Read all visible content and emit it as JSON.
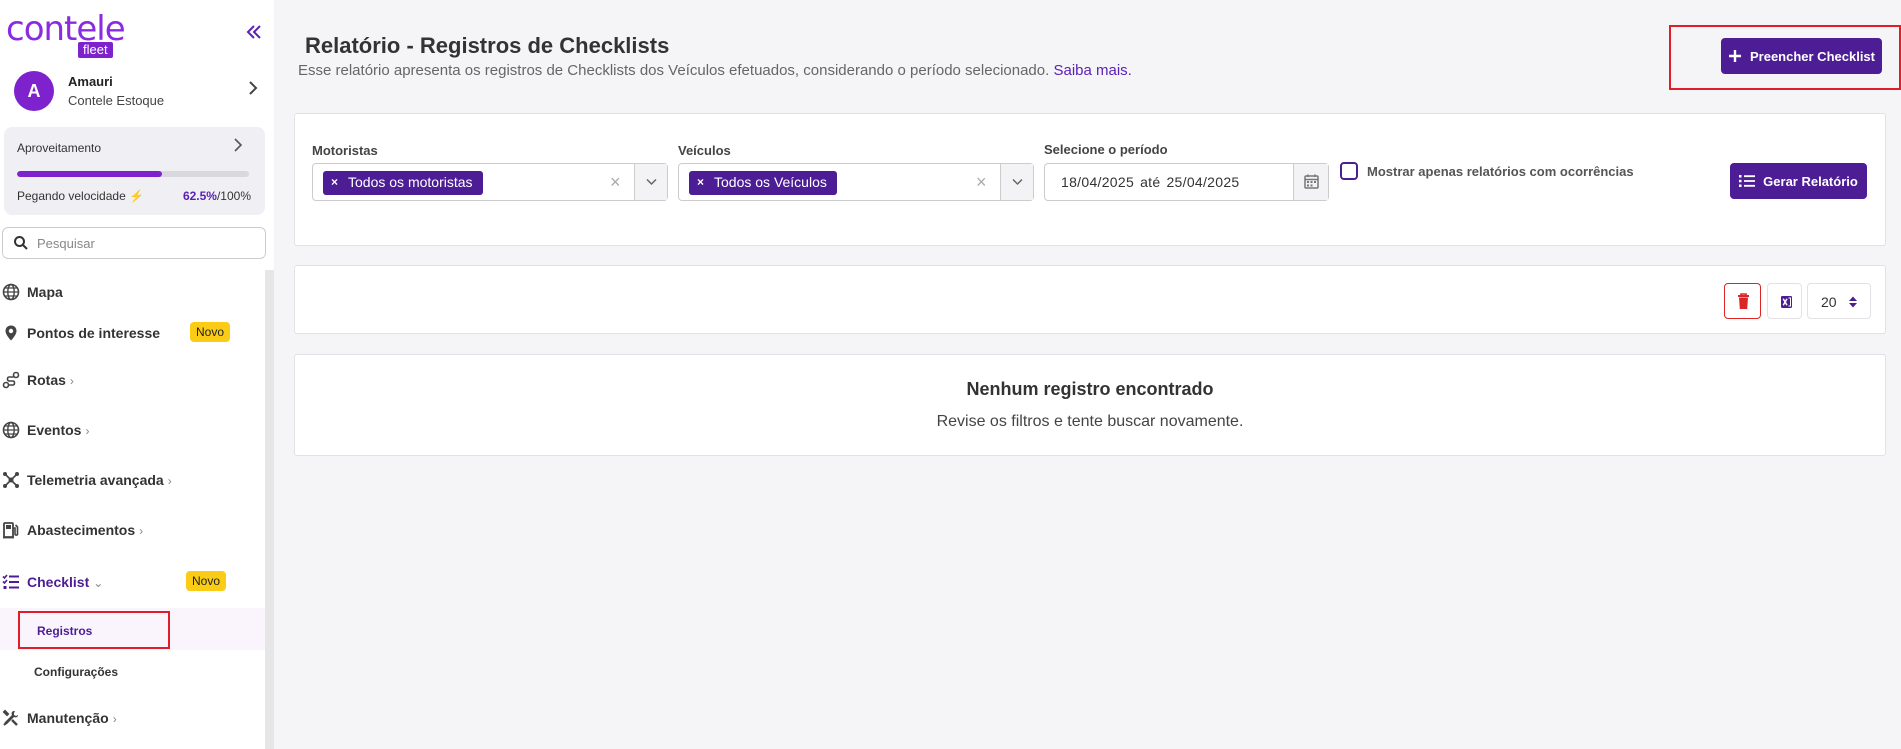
{
  "brand": {
    "logo_word": "contele",
    "logo_sub": "fleet",
    "accent": "#4c1d95",
    "primary": "#7e22ce"
  },
  "sidebar": {
    "collapse_icon": "double-chevron-left-icon",
    "user": {
      "initial": "A",
      "name": "Amauri",
      "company": "Contele Estoque"
    },
    "usage": {
      "title": "Aproveitamento",
      "status": "Pegando velocidade",
      "percent_label": "62.5%",
      "total_label": "/100%",
      "progress": 0.625
    },
    "search": {
      "placeholder": "Pesquisar"
    },
    "items": [
      {
        "label": "Mapa",
        "icon": "globe-icon",
        "chevron": ""
      },
      {
        "label": "Pontos de interesse",
        "icon": "map-pin-icon",
        "chevron": "",
        "badge": "Novo"
      },
      {
        "label": "Rotas",
        "icon": "route-icon",
        "chevron": "›"
      },
      {
        "label": "Eventos",
        "icon": "globe-icon",
        "chevron": "›"
      },
      {
        "label": "Telemetria avançada",
        "icon": "network-icon",
        "chevron": "›"
      },
      {
        "label": "Abastecimentos",
        "icon": "fuel-pump-icon",
        "chevron": "›"
      },
      {
        "label": "Checklist",
        "icon": "checklist-icon",
        "chevron": "⌄",
        "badge": "Novo"
      },
      {
        "label": "Manutenção",
        "icon": "tools-icon",
        "chevron": "›"
      }
    ],
    "subitems": [
      {
        "label": "Registros"
      },
      {
        "label": "Configurações"
      }
    ]
  },
  "header": {
    "title": "Relatório - Registros de Checklists",
    "description": "Esse relatório apresenta os registros de Checklists dos Veículos efetuados, considerando o período selecionado.",
    "learn_more": "Saiba mais.",
    "fill_button": "Preencher Checklist"
  },
  "filters": {
    "drivers_label": "Motoristas",
    "drivers_chip": "Todos os motoristas",
    "vehicles_label": "Veículos",
    "vehicles_chip": "Todos os Veículos",
    "period_label": "Selecione o período",
    "date_from": "18/04/2025",
    "date_sep": "até",
    "date_to": "25/04/2025",
    "only_occurrences_label": "Mostrar apenas relatórios com ocorrências",
    "generate_button": "Gerar Relatório"
  },
  "toolbar": {
    "page_size": "20"
  },
  "empty_state": {
    "title": "Nenhum registro encontrado",
    "subtitle": "Revise os filtros e tente buscar novamente."
  }
}
